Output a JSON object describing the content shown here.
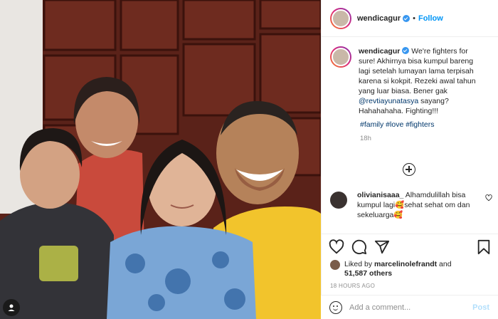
{
  "header": {
    "username": "wendicagur",
    "dot": "•",
    "follow_label": "Follow"
  },
  "caption": {
    "username": "wendicagur",
    "text_1": "We're fighters for sure! Akhirnya bisa kumpul bareng lagi setelah lumayan lama terpisah karena si kokpit. Rezeki awal tahun yang luar biasa. Bener gak ",
    "mention": "@revtiayunatasya",
    "text_2": " sayang? Hahahahaha. Fighting!!!",
    "hashtags": "#family #love #fighters",
    "time": "18h"
  },
  "comment": {
    "username": "olivianisaaa_",
    "text_1": "Alhamdulillah bisa kumpul lagi",
    "emoji_1": "🥰",
    "text_2": "sehat sehat om dan sekeluarga",
    "emoji_2": "🥰"
  },
  "likes": {
    "prefix": "Liked by ",
    "user": "marcelinolefrandt",
    "middle": " and",
    "count": "51,587 others"
  },
  "posted_ago": "18 HOURS AGO",
  "add_comment": {
    "placeholder": "Add a comment...",
    "post_label": "Post"
  },
  "icons": {
    "verified": "verified-badge-icon",
    "plus": "plus-circle-icon",
    "heart": "heart-icon",
    "comment": "comment-icon",
    "share": "share-icon",
    "save": "bookmark-icon",
    "emoji": "emoji-icon",
    "tag": "user-tag-icon"
  },
  "colors": {
    "accent": "#0095f6",
    "link": "#00376b",
    "muted": "#8e8e8e",
    "post_disabled": "#b2dffc"
  }
}
